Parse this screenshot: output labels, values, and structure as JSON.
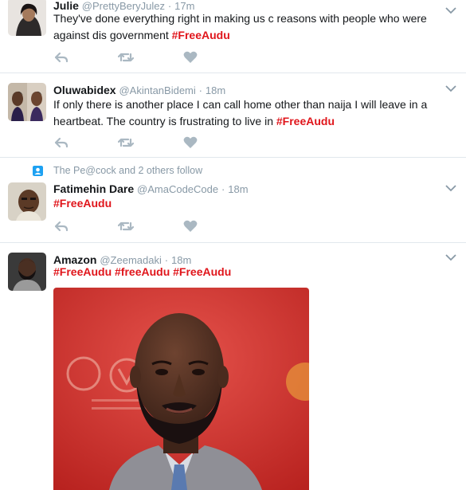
{
  "tweets": [
    {
      "name": "Julie",
      "handle": "@PrettyBeryJulez",
      "time": "17m",
      "text_parts": [
        "They've done everything right in making us c reasons  with people  who were against dis government ",
        "#FreeAudu"
      ]
    },
    {
      "name": "Oluwabidex",
      "handle": "@AkintanBidemi",
      "time": "18m",
      "text_parts": [
        "If only there is another place I can call home other than naija I will leave in a heartbeat. The country is frustrating to live in ",
        "#FreeAudu"
      ]
    },
    {
      "context": "The Pe@cock and 2 others follow",
      "name": "Fatimehin Dare",
      "handle": "@AmaCodeCode",
      "time": "18m",
      "hashtags": [
        "#FreeAudu"
      ]
    },
    {
      "name": "Amazon",
      "handle": "@Zeemadaki",
      "time": "18m",
      "hashtags": [
        "#FreeAudu",
        "#freeAudu",
        "#FreeAudu"
      ]
    }
  ],
  "separator": "·",
  "icons": {
    "reply": "reply-icon",
    "retweet": "retweet-icon",
    "like": "heart-icon",
    "caret": "chevron-down-icon",
    "follow": "person-icon"
  },
  "colors": {
    "hashtag": "#e0151b",
    "muted": "#8899a6",
    "action": "#aab8c2"
  }
}
